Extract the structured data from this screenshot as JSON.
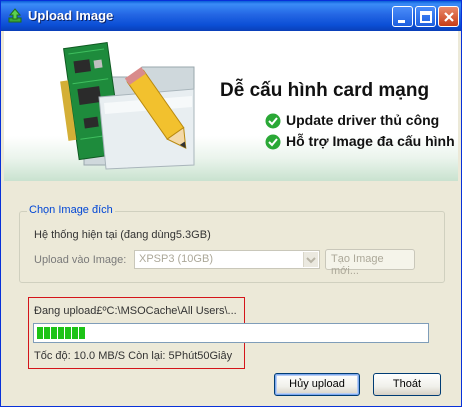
{
  "window": {
    "title": "Upload Image"
  },
  "banner": {
    "title": "Dễ cấu hình card mạng",
    "features": [
      "Update driver thủ công",
      "Hỗ trợ Image đa cấu hình"
    ]
  },
  "target_group": {
    "legend": "Chọn Image đích",
    "current_system": "Hệ thống hiện tại (đang dùng5.3GB)",
    "upload_label": "Upload vào Image:",
    "select_value": "XPSP3    (10GB)",
    "new_image_button": "Tạo Image mới..."
  },
  "status": {
    "uploading": "Đang upload£ºC:\\MSOCache\\All Users\\...",
    "progress_fraction": 0.135,
    "speed": "Tốc độ: 10.0 MB/S  Còn lại: 5Phút50Giây"
  },
  "buttons": {
    "cancel": "Hủy upload",
    "exit": "Thoát"
  },
  "colors": {
    "accent": "#0046d5",
    "progress": "#1cc316",
    "highlight_box": "#d4141a",
    "check": "#2aa836"
  }
}
